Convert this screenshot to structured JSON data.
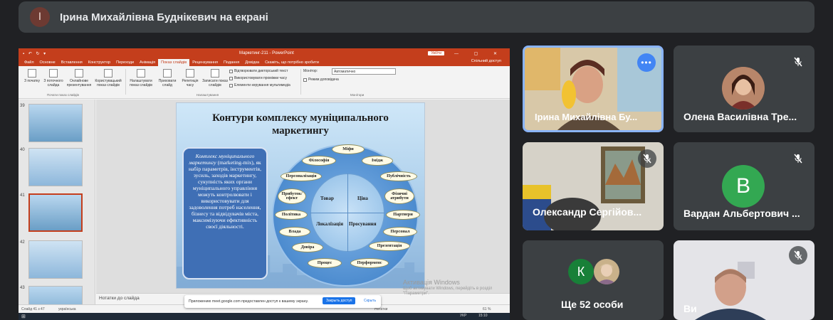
{
  "banner": {
    "initial": "І",
    "text": "Ірина Михайлівна Буднікевич на екрані"
  },
  "ppt": {
    "quick_access": "▪ ↶ ↻ ▾",
    "doc_title": "Маркетинг-211  -  PowerPoint",
    "signin": "Увійти",
    "window_buttons": "▭ — ▢ ✕",
    "tabs": [
      "Файл",
      "Основне",
      "Вставлення",
      "Конструктор",
      "Переходи",
      "Анімація",
      "Показ слайдів",
      "Рецензування",
      "Подання",
      "Довідка",
      "Скажіть, що потрібно зробити"
    ],
    "share": "Спільний доступ",
    "ribbon": {
      "b1": "З початку",
      "b2": "З поточного слайда",
      "b3": "Онлайнове презентування",
      "b4": "Користувацький показ слайдів",
      "b5": "Налаштувати показ слайдів",
      "b6": "Приховати слайд",
      "b7": "Репетиція часу",
      "b8": "Записати показ слайдів",
      "g1": "Почати показ слайдів",
      "g2": "Налаштування",
      "g3": "Монітори",
      "c1": "Відтворювати дикторський текст",
      "c2": "Використовувати проміжки часу",
      "c3": "Елементи керування мультимедіа",
      "monitor_label": "Монітор:",
      "monitor_value": "Автоматично",
      "presenter": "Режим доповідача"
    },
    "thumb_numbers": [
      "39",
      "40",
      "41",
      "42",
      "43"
    ],
    "notes": "Нотатки до слайда",
    "status": {
      "slide": "Слайд 41 з 47",
      "lang": "українська",
      "notes": "Нотатки",
      "zoom": "61 %"
    },
    "sharebar": {
      "text": "Приложению meet.google.com предоставлен доступ к вашему экрану.",
      "stop": "Закрыть доступ",
      "hide": "Скрыть"
    },
    "watermark": {
      "title": "Активація Windows",
      "line1": "Щоб активувати Windows, перейдіть в розділ",
      "line2": "\"Параметри\"."
    },
    "taskbar": {
      "lang": "УКР",
      "time": "15:10"
    }
  },
  "slide": {
    "title_line1": "Контури комплексу муніципального",
    "title_line2": "маркетингу",
    "definition_italic": "Комплекс муніципального маркетингу",
    "definition_rest": " (marketing-mix), як набір параметрів, інструментів, зусиль, заходів маркетингу, сукупність яких органи муніципального управління можуть контролювати і використовувати для задоволення потреб населення, бізнесу та відвідувачів міста, максимізуючи ефективність своєї діяльності.",
    "quadrants": [
      "Товар",
      "Ціна",
      "Локалізація",
      "Просування"
    ],
    "pills": [
      "Міфи",
      "Філософія",
      "Імідж",
      "Персоналізація",
      "Публічність",
      "Прибуток/ ефект",
      "Фізичні атрибути",
      "Політика",
      "Партнери",
      "Влада",
      "Персонал",
      "Довіра",
      "Презентація",
      "Процес",
      "Перформенс"
    ]
  },
  "tiles": {
    "t1_name": "Ірина Михайлівна Бу...",
    "t1_more": "•••",
    "t2_name": "Олена Василівна Тре...",
    "t3_name": "Олександр Сергійов...",
    "t4_initial": "В",
    "t4_name": "Вардан Альбертович ...",
    "t5_initial": "К",
    "t5_name": "Ще 52 особи",
    "t6_name": "Ви"
  },
  "colors": {
    "accent_ppt": "#c43e1c",
    "meet_bg": "#202124",
    "tile_bg": "#3c4043",
    "active_border": "#8ab4f8"
  }
}
